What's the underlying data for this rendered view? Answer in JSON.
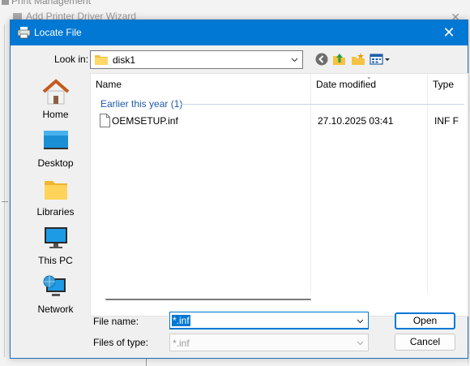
{
  "background": {
    "window1_title": "Print Management",
    "window2_title": "Add Printer Driver Wizard"
  },
  "dialog": {
    "title": "Locate File",
    "close_glyph": "✕",
    "title_bar_color": "#0078d4"
  },
  "lookin": {
    "label": "Look in:",
    "value": "disk1"
  },
  "toolbar": {
    "icons": [
      "back-icon",
      "up-folder-icon",
      "new-folder-icon",
      "view-menu-icon"
    ]
  },
  "places": [
    {
      "label": "Home",
      "icon": "home-icon"
    },
    {
      "label": "Desktop",
      "icon": "desktop-icon"
    },
    {
      "label": "Libraries",
      "icon": "libraries-icon"
    },
    {
      "label": "This PC",
      "icon": "this-pc-icon"
    },
    {
      "label": "Network",
      "icon": "network-icon"
    }
  ],
  "file_list": {
    "columns": [
      "Name",
      "Date modified",
      "Type"
    ],
    "group_label": "Earlier this year (1)",
    "files": [
      {
        "name": "OEMSETUP.inf",
        "date_modified": "27.10.2025 03:41",
        "type": "INF F"
      }
    ]
  },
  "filename": {
    "label": "File name:",
    "value": "*.inf"
  },
  "filetype": {
    "label": "Files of type:",
    "value": "*.inf"
  },
  "buttons": {
    "open": "Open",
    "cancel": "Cancel"
  }
}
